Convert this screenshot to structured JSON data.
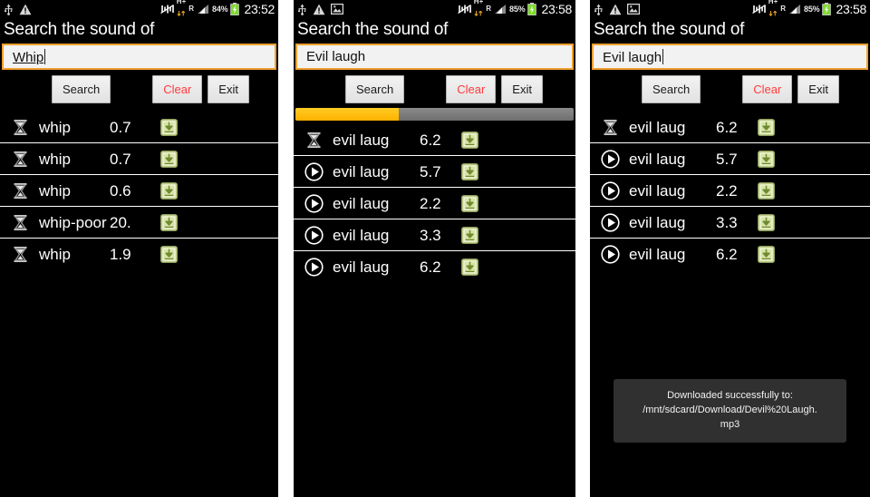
{
  "app": {
    "title": "Search the sound of",
    "buttons": {
      "search": "Search",
      "clear": "Clear",
      "exit": "Exit"
    },
    "accent_orange": "#f0a030",
    "clear_red": "#ff3b3b",
    "progress_yellow": "#ffb000",
    "progress_track_gray": "#7a7a7a",
    "download_icon_green": "#c6d98a"
  },
  "panels": [
    {
      "id": "panel-1",
      "statusbar": {
        "icons_left": [
          "usb-icon",
          "warning-icon"
        ],
        "icons_right": [
          "mute-vibrate-off-icon",
          "hplus-data-icon",
          "roaming-icon",
          "signal-bars-icon"
        ],
        "hplus_label": "H+",
        "roaming_label": "R",
        "battery_percent": "84%",
        "battery_icon": "battery-charging-icon",
        "time": "23:52"
      },
      "search_value": "Whip",
      "search_placeholder": "Search the sound of",
      "progress": {
        "visible": false,
        "percent": 0
      },
      "toast": null,
      "rows": [
        {
          "state_icon": "hourglass-icon",
          "name": "whip",
          "duration": "0.7",
          "download": "download-icon"
        },
        {
          "state_icon": "hourglass-icon",
          "name": "whip",
          "duration": "0.7",
          "download": "download-icon"
        },
        {
          "state_icon": "hourglass-icon",
          "name": "whip",
          "duration": "0.6",
          "download": "download-icon"
        },
        {
          "state_icon": "hourglass-icon",
          "name": "whip-poor",
          "duration": "20.",
          "download": "download-icon"
        },
        {
          "state_icon": "hourglass-icon",
          "name": "whip",
          "duration": "1.9",
          "download": "download-icon"
        }
      ]
    },
    {
      "id": "panel-2",
      "statusbar": {
        "icons_left": [
          "usb-icon",
          "warning-icon",
          "image-icon"
        ],
        "icons_right": [
          "mute-vibrate-off-icon",
          "hplus-data-icon",
          "roaming-icon",
          "signal-bars-icon"
        ],
        "hplus_label": "H+",
        "roaming_label": "R",
        "battery_percent": "85%",
        "battery_icon": "battery-charging-icon",
        "time": "23:58"
      },
      "search_value": "Evil laugh",
      "search_placeholder": "Search the sound of",
      "progress": {
        "visible": true,
        "percent": 37
      },
      "toast": null,
      "rows": [
        {
          "state_icon": "hourglass-icon",
          "name": "evil laug",
          "duration": "6.2",
          "download": "download-icon"
        },
        {
          "state_icon": "play-icon",
          "name": "evil laug",
          "duration": "5.7",
          "download": "download-icon"
        },
        {
          "state_icon": "play-icon",
          "name": "evil laug",
          "duration": "2.2",
          "download": "download-icon"
        },
        {
          "state_icon": "play-icon",
          "name": "evil laug",
          "duration": "3.3",
          "download": "download-icon"
        },
        {
          "state_icon": "play-icon",
          "name": "evil laug",
          "duration": "6.2",
          "download": "download-icon"
        }
      ]
    },
    {
      "id": "panel-3",
      "statusbar": {
        "icons_left": [
          "usb-icon",
          "warning-icon",
          "image-icon"
        ],
        "icons_right": [
          "mute-vibrate-off-icon",
          "hplus-data-icon",
          "roaming-icon",
          "signal-bars-icon"
        ],
        "hplus_label": "H+",
        "roaming_label": "R",
        "battery_percent": "85%",
        "battery_icon": "battery-charging-icon",
        "time": "23:58"
      },
      "search_value": "Evil laugh",
      "search_placeholder": "Search the sound of",
      "progress": {
        "visible": false,
        "percent": 0
      },
      "toast": {
        "line1": "Downloaded successfully to:",
        "line2": "/mnt/sdcard/Download/Devil%20Laugh.",
        "line3": "mp3"
      },
      "rows": [
        {
          "state_icon": "hourglass-icon",
          "name": "evil laug",
          "duration": "6.2",
          "download": "download-icon"
        },
        {
          "state_icon": "play-icon",
          "name": "evil laug",
          "duration": "5.7",
          "download": "download-icon"
        },
        {
          "state_icon": "play-icon",
          "name": "evil laug",
          "duration": "2.2",
          "download": "download-icon"
        },
        {
          "state_icon": "play-icon",
          "name": "evil laug",
          "duration": "3.3",
          "download": "download-icon"
        },
        {
          "state_icon": "play-icon",
          "name": "evil laug",
          "duration": "6.2",
          "download": "download-icon"
        }
      ]
    }
  ]
}
